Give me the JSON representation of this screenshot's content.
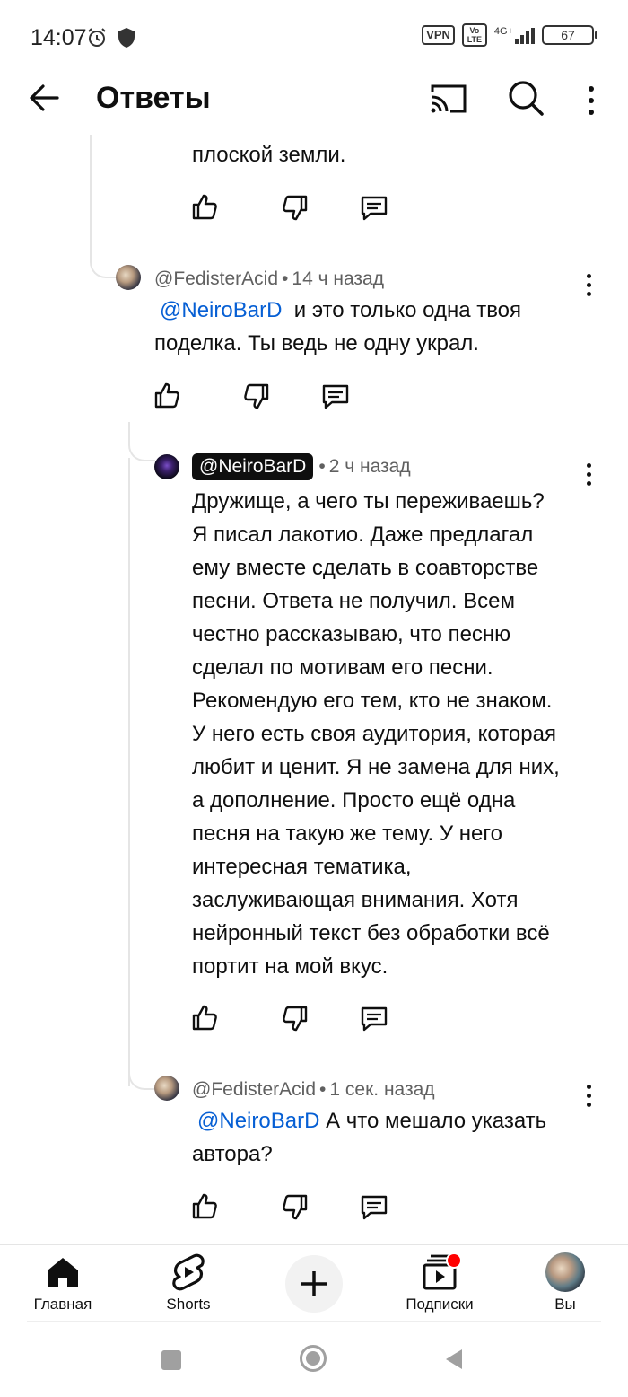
{
  "status_bar": {
    "time": "14:07",
    "vpn": "VPN",
    "volte": "Vo LTE",
    "network": "4G+",
    "battery": "67"
  },
  "header": {
    "title": "Ответы",
    "icons": [
      "back-arrow-icon",
      "cast-icon",
      "search-icon",
      "more-vert-icon"
    ]
  },
  "partial_comment": {
    "text_tail": "плоской земли."
  },
  "comments": [
    {
      "author": "@FedisterAcid",
      "time": "14 ч назад",
      "mention": "@NeiroBarD",
      "text_line1": "и это только одна твоя",
      "text_line2": "поделка. Ты ведь не одну украл."
    },
    {
      "author": "@NeiroBarD",
      "time": "2 ч назад",
      "lines": [
        "Дружище, а чего ты переживаешь?",
        "Я писал лакотио. Даже предлагал",
        "ему вместе сделать в соавторстве",
        "песни. Ответа не получил. Всем",
        "честно рассказываю, что песню",
        "сделал по мотивам его песни.",
        "Рекомендую его тем, кто не знаком.",
        "У него есть своя аудитория, которая",
        "любит и ценит. Я не замена для них,",
        "а дополнение. Просто ещё одна",
        "песня на такую же тему. У него",
        "интересная тематика,",
        "заслуживающая внимания. Хотя",
        "нейронный текст без обработки всё",
        "портит на мой вкус."
      ]
    },
    {
      "author": "@FedisterAcid",
      "time": "1 сек. назад",
      "mention": "@NeiroBarD",
      "text_line1": "А что мешало указать",
      "text_line2": "автора?"
    }
  ],
  "bottom_nav": {
    "home": "Главная",
    "shorts": "Shorts",
    "subscriptions": "Подписки",
    "you": "Вы"
  },
  "colors": {
    "mention": "#065fd4",
    "meta_text": "#606060",
    "notification_dot": "#ff0000"
  }
}
